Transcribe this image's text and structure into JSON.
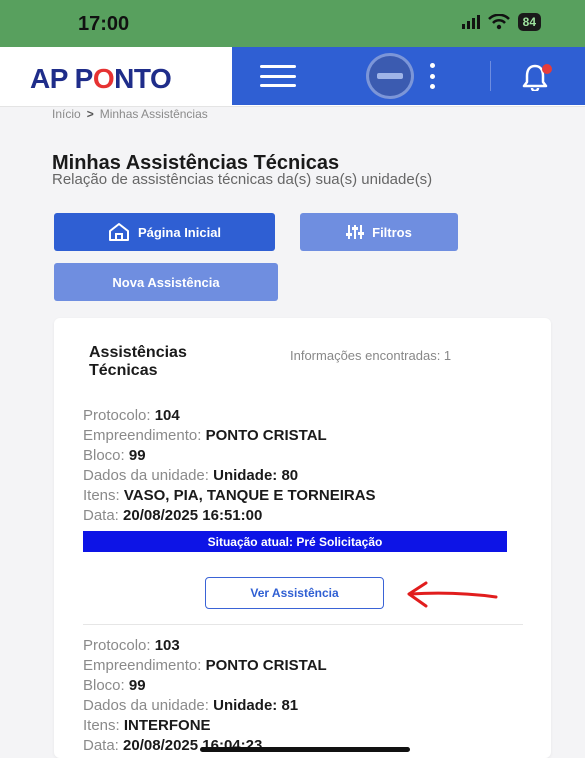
{
  "status_bar": {
    "time": "17:00",
    "battery": "84"
  },
  "header": {
    "logo_part1": "AP P",
    "logo_part2": "O",
    "logo_part3": "NTO"
  },
  "breadcrumb": {
    "home": "Início",
    "separator": ">",
    "current": "Minhas Assistências"
  },
  "page": {
    "title": "Minhas Assistências Técnicas",
    "subtitle": "Relação de assistências técnicas da(s) sua(s) unidade(s)"
  },
  "actions": {
    "home_label": "Página Inicial",
    "filters_label": "Filtros",
    "new_label": "Nova Assistência"
  },
  "card": {
    "title": "Assistências Técnicas",
    "info": "Informações encontradas: 1",
    "labels": {
      "protocolo": "Protocolo:",
      "empreendimento": "Empreendimento:",
      "bloco": "Bloco:",
      "dados": "Dados da unidade:",
      "itens": "Itens:",
      "data": "Data:"
    },
    "records": [
      {
        "protocolo": "104",
        "empreendimento": "PONTO CRISTAL",
        "bloco": "99",
        "dados": "Unidade: 80",
        "itens": "VASO, PIA, TANQUE E TORNEIRAS",
        "data": "20/08/2025 16:51:00",
        "status": "Situação atual: Pré Solicitação",
        "action": "Ver Assistência"
      },
      {
        "protocolo": "103",
        "empreendimento": "PONTO CRISTAL",
        "bloco": "99",
        "dados": "Unidade: 81",
        "itens": "INTERFONE",
        "data": "20/08/2025 16:04:23"
      }
    ]
  },
  "colors": {
    "status_green": "#58a05e",
    "primary_blue": "#2f5fd3",
    "light_blue": "#6f8ee0",
    "status_strip": "#0d14e6",
    "arrow_red": "#e11d1d"
  }
}
